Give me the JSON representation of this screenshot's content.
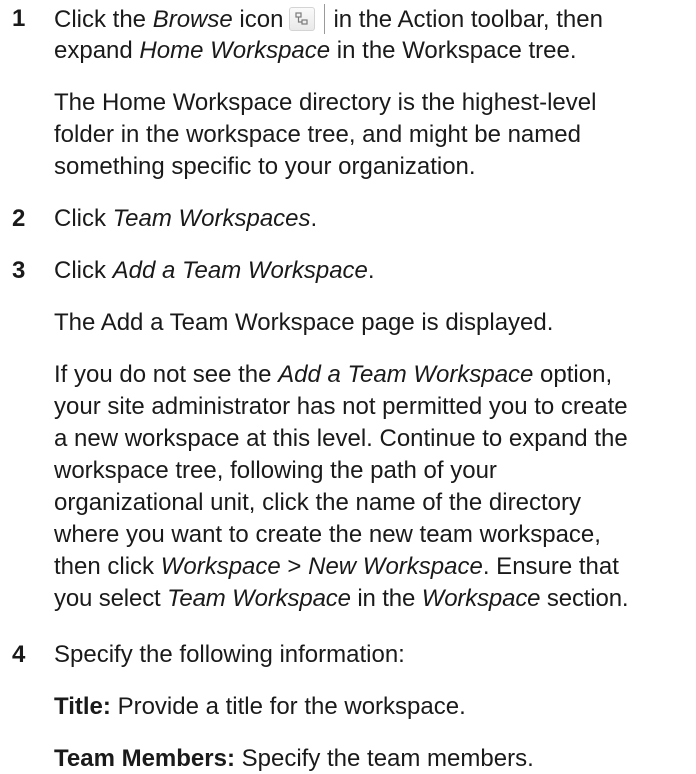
{
  "steps": [
    {
      "number": "1",
      "line1": {
        "pre": "Click the ",
        "em1": "Browse",
        "post": " icon",
        "post2": "in the Action toolbar, then"
      },
      "line2": {
        "pre": "expand ",
        "em": "Home Workspace",
        "post": " in the Workspace tree."
      },
      "note": [
        "The Home Workspace directory is the highest-level",
        "folder in the workspace tree, and might be named",
        "something specific to your organization."
      ]
    },
    {
      "number": "2",
      "pre": "Click ",
      "em": "Team Workspaces",
      "post": "."
    },
    {
      "number": "3",
      "pre": "Click ",
      "em": "Add a Team Workspace",
      "post": ".",
      "result": "The Add a Team Workspace page is displayed.",
      "note": {
        "l1_pre": "If you do not see the ",
        "l1_em": "Add a Team Workspace",
        "l1_post": " option,",
        "l2": "your site administrator has not permitted you to create",
        "l3": "a new workspace at this level. Continue to expand the",
        "l4": "workspace tree, following the path of your",
        "l5": "organizational unit, click the name of the directory",
        "l6": "where you want to create the new team workspace,",
        "l7_pre": "then click ",
        "l7_em1": "Workspace",
        "l7_mid": " > ",
        "l7_em2": "New Workspace",
        "l7_post": ". Ensure that",
        "l8_pre": "you select ",
        "l8_em1": "Team Workspace",
        "l8_mid": " in the ",
        "l8_em2": "Workspace",
        "l8_post": " section."
      }
    },
    {
      "number": "4",
      "text": "Specify the following information:",
      "fields": [
        {
          "label": "Title:",
          "desc": " Provide a title for the workspace."
        },
        {
          "label": "Team Members:",
          "desc": " Specify the team members."
        }
      ]
    }
  ],
  "icons": {
    "browse": "tree-browse-icon"
  }
}
